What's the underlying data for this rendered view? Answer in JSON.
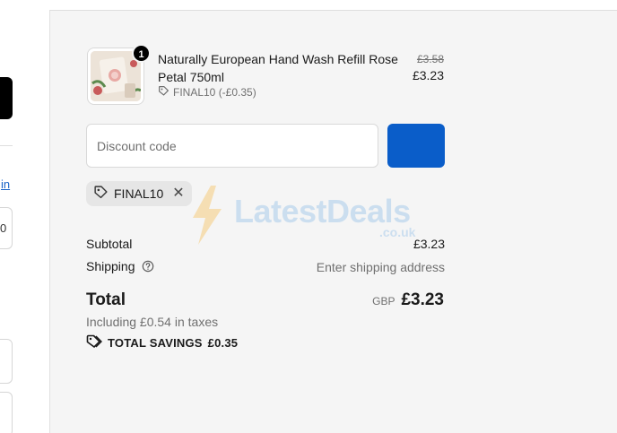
{
  "left_form": {
    "link_fragment": "in",
    "field_fragment": "0"
  },
  "cart": {
    "item": {
      "name": "Naturally European Hand Wash Refill Rose Petal 750ml",
      "quantity": "1",
      "discount_code": "FINAL10 (-£0.35)",
      "original_price": "£3.58",
      "price": "£3.23",
      "image_icon": "product-thumbnail"
    }
  },
  "discount": {
    "placeholder": "Discount code",
    "value": "",
    "apply_button_label": "",
    "applied_code": "FINAL10",
    "remove_icon": "close-icon"
  },
  "watermark": {
    "text": "LatestDeals",
    "sub": ".co.uk"
  },
  "summary": {
    "subtotal_label": "Subtotal",
    "subtotal_value": "£3.23",
    "shipping_label": "Shipping",
    "shipping_value": "Enter shipping address",
    "total_label": "Total",
    "currency": "GBP",
    "total_value": "£3.23",
    "taxes_text": "Including £0.54 in taxes",
    "savings_label": "TOTAL SAVINGS",
    "savings_value": "£0.35"
  },
  "colors": {
    "accent": "#0a5dc9",
    "background": "#f5f5f5",
    "muted_text": "#707070"
  }
}
